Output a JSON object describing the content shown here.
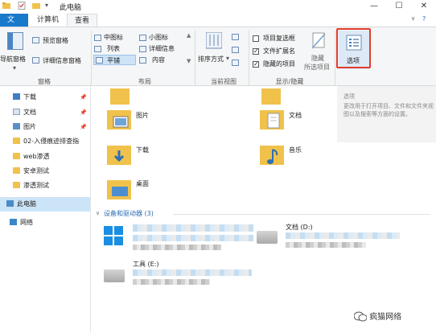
{
  "window": {
    "title": "此电脑",
    "controls": {
      "minimize": "—",
      "maximize": "☐",
      "close": "✕"
    }
  },
  "ribbon_tabs": {
    "file": "文件",
    "computer": "计算机",
    "view": "查看"
  },
  "ribbon": {
    "panes": {
      "nav_pane": "导航窗格",
      "preview_pane": "预览窗格",
      "details_pane": "详细信息窗格",
      "group_label": "窗格"
    },
    "layout": {
      "medium_icons": "中图标",
      "small_icons": "小图标",
      "list": "列表",
      "details": "详细信息",
      "tiles": "平铺",
      "content": "内容",
      "group_label": "布局"
    },
    "current_view": {
      "sort_by": "排序方式",
      "group_label": "当前视图"
    },
    "show_hide": {
      "item_checkboxes": "项目复选框",
      "file_extensions": "文件扩展名",
      "hidden_items": "隐藏的项目",
      "hide_selected": "隐藏",
      "hide_selected_2": "所选项目",
      "group_label": "显示/隐藏"
    },
    "options": "选项"
  },
  "nav": {
    "items": [
      {
        "label": "下载",
        "pinned": true
      },
      {
        "label": "文档",
        "pinned": true
      },
      {
        "label": "图片",
        "pinned": true
      },
      {
        "label": "02-入侵痕迹排查指",
        "pinned": false
      },
      {
        "label": "web渗透",
        "pinned": false
      },
      {
        "label": "安卓测试",
        "pinned": false
      },
      {
        "label": "渗透测试",
        "pinned": false
      },
      {
        "label": "此电脑",
        "pinned": false
      },
      {
        "label": "网络",
        "pinned": false
      }
    ]
  },
  "content": {
    "folders": [
      {
        "label": "图片"
      },
      {
        "label": "文档"
      },
      {
        "label": "下载"
      },
      {
        "label": "音乐"
      },
      {
        "label": "桌面"
      }
    ],
    "devices_header": "设备和驱动器 (3)",
    "drives": [
      {
        "label": "文档 (D:)"
      },
      {
        "label": "工具 (E:)"
      }
    ]
  },
  "preview": {
    "title": "选项",
    "text": "更改用于打开项目、文件和文件夹视图以及搜索等方面的设置。"
  },
  "watermark": "疯猫网络"
}
